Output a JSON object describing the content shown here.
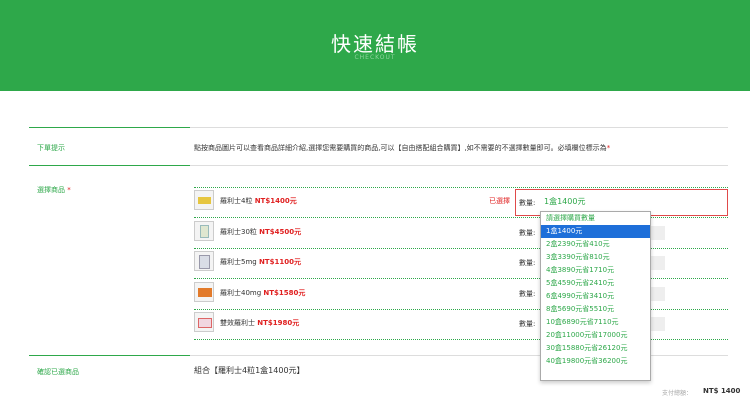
{
  "header": {
    "title": "快速結帳",
    "subtitle": "CHECKOUT"
  },
  "sections": {
    "order_hint_label": "下單提示",
    "select_label": "選擇商品",
    "confirm_label": "確認已選商品"
  },
  "note": {
    "text": "點按商品圖片可以查看商品詳細介紹,選擇您需要購買的商品,可以【自由搭配組合購買】,如不需要的不選擇數量即可。必填欄位標示為",
    "required_mark": "*"
  },
  "products": [
    {
      "name": "羅利士4粒",
      "price": "NT$1400元"
    },
    {
      "name": "羅利士30粒",
      "price": "NT$4500元"
    },
    {
      "name": "羅利士5mg",
      "price": "NT$1100元"
    },
    {
      "name": "羅利士40mg",
      "price": "NT$1580元"
    },
    {
      "name": "雙效羅利士",
      "price": "NT$1980元"
    }
  ],
  "qty_label": "數量:",
  "selected_tag": "已選擇",
  "selected_value": "1盒1400元",
  "dropdown_options": [
    "請選擇購買數量",
    "1盒1400元",
    "2盒2390元省410元",
    "3盒3390元省810元",
    "4盒3890元省1710元",
    "5盒4590元省2410元",
    "6盒4990元省3410元",
    "8盒5690元省5510元",
    "10盒6890元省7110元",
    "20盒11000元省17000元",
    "30盒15880元省26120元",
    "40盒19800元省36200元"
  ],
  "dropdown_active_index": 1,
  "combo_text": "組合【羅利士4粒1盒1400元】",
  "total": {
    "label": "支付總額：",
    "value": "NT$ 1400"
  },
  "colors": {
    "brand": "#2ea84a",
    "price": "#e02020",
    "highlight": "#1e6fd9"
  }
}
